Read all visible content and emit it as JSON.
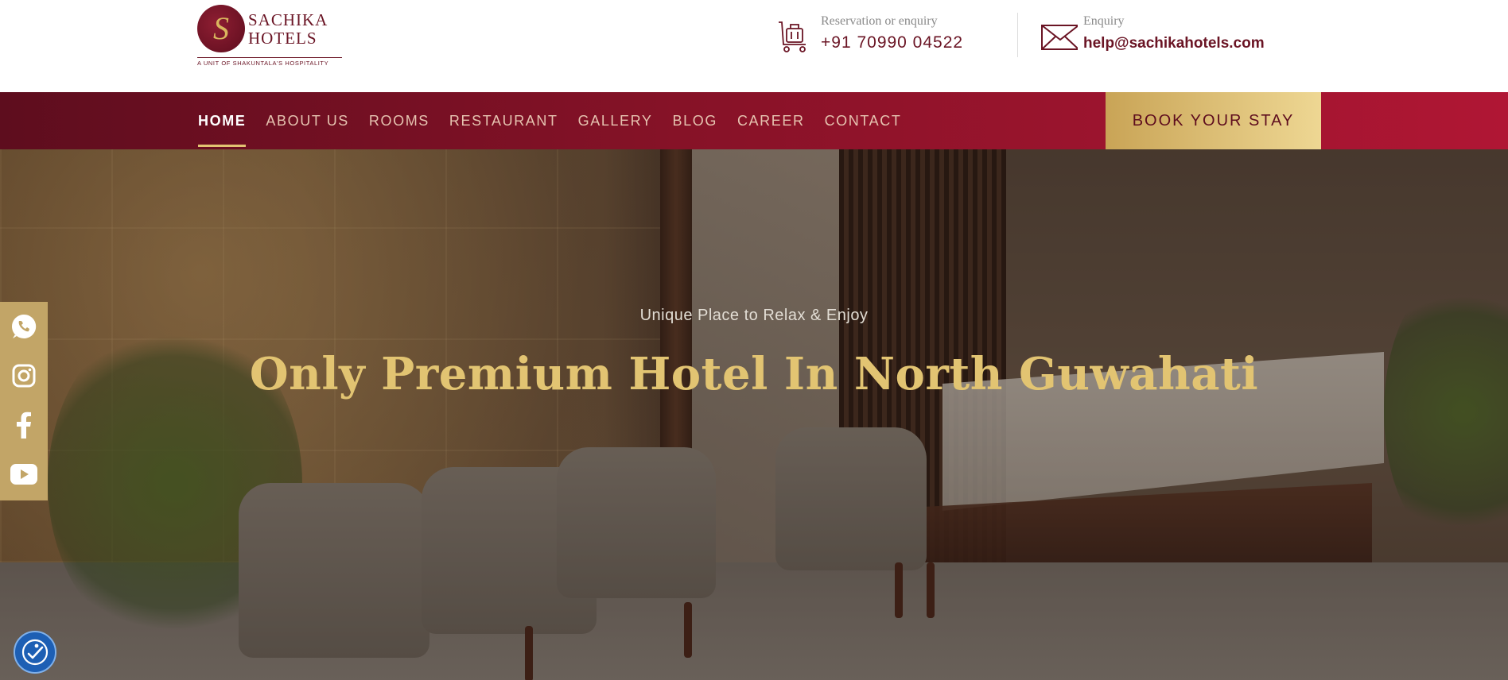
{
  "brand": {
    "logo_letter": "S",
    "name_line1": "SACHIKA",
    "name_line2": "HOTELS",
    "tagline": "A UNIT OF SHAKUNTALA'S HOSPITALITY",
    "color_primary": "#6a1424",
    "color_gold": "#e2c472"
  },
  "contact": {
    "phone_label": "Reservation or enquiry",
    "phone_value": "+91 70990 04522",
    "phone_icon": "luggage-trolley-icon",
    "email_label": "Enquiry",
    "email_value": "help@sachikahotels.com",
    "email_icon": "envelope-icon"
  },
  "nav": {
    "items": [
      {
        "label": "HOME",
        "active": true
      },
      {
        "label": "ABOUT US"
      },
      {
        "label": "ROOMS"
      },
      {
        "label": "RESTAURANT"
      },
      {
        "label": "GALLERY"
      },
      {
        "label": "BLOG"
      },
      {
        "label": "CAREER"
      },
      {
        "label": "CONTACT"
      }
    ],
    "cta_label": "BOOK YOUR STAY"
  },
  "hero": {
    "subtitle": "Unique Place to Relax & Enjoy",
    "title": "Only Premium Hotel In North Guwahati"
  },
  "social": {
    "icons": [
      "whatsapp-icon",
      "instagram-icon",
      "facebook-icon",
      "youtube-icon"
    ]
  },
  "accessibility": {
    "icon": "accessibility-icon"
  }
}
